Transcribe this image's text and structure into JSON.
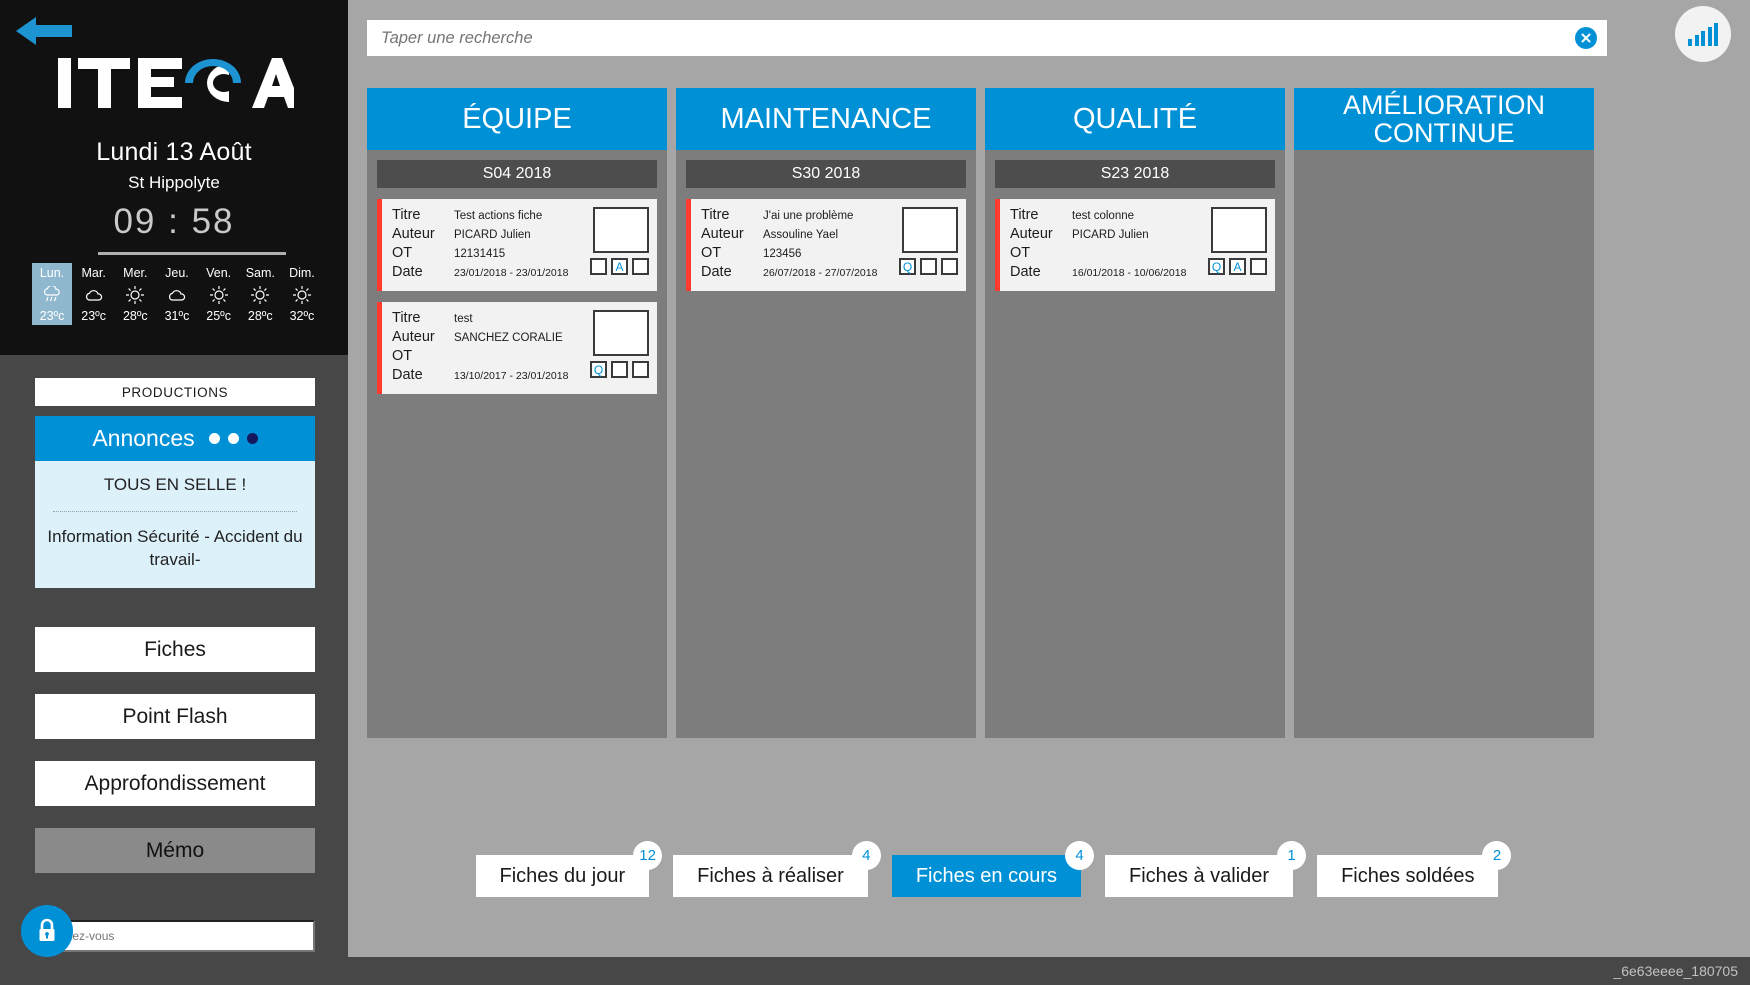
{
  "sidebar": {
    "back_icon": "back-arrow-icon",
    "logo_text": "ITECA",
    "date": "Lundi 13 Août",
    "city": "St Hippolyte",
    "clock": "09 : 58",
    "forecast": [
      {
        "day": "Lun.",
        "icon": "rain-icon",
        "temp": "23ºc",
        "active": true
      },
      {
        "day": "Mar.",
        "icon": "cloud-icon",
        "temp": "23ºc",
        "active": false
      },
      {
        "day": "Mer.",
        "icon": "sun-icon",
        "temp": "28ºc",
        "active": false
      },
      {
        "day": "Jeu.",
        "icon": "cloud-icon",
        "temp": "31ºc",
        "active": false
      },
      {
        "day": "Ven.",
        "icon": "sun-icon",
        "temp": "25ºc",
        "active": false
      },
      {
        "day": "Sam.",
        "icon": "sun-icon",
        "temp": "28ºc",
        "active": false
      },
      {
        "day": "Dim.",
        "icon": "sun-icon",
        "temp": "32ºc",
        "active": false
      }
    ],
    "productions_label": "PRODUCTIONS",
    "annonces": {
      "title": "Annonces",
      "dots_total": 3,
      "dot_selected_index": 2,
      "headline": "TOUS EN SELLE !",
      "body": "Information Sécurité - Accident du travail-"
    },
    "buttons": {
      "fiches": "Fiches",
      "point_flash": "Point Flash",
      "approfondissement": "Approfondissement",
      "memo": "Mémo"
    },
    "login": {
      "lock_icon": "lock-icon",
      "placeholder": "Identifiez-vous",
      "value": ""
    }
  },
  "topbar": {
    "search": {
      "placeholder": "Taper une recherche",
      "value": "",
      "clear_icon": "close-circle-icon"
    },
    "signal_icon": "signal-bars-icon"
  },
  "board": {
    "columns": [
      {
        "title": "ÉQUIPE",
        "week": "S04 2018",
        "cards": [
          {
            "labels": {
              "titre": "Titre",
              "auteur": "Auteur",
              "ot": "OT",
              "date": "Date"
            },
            "titre": "Test actions fiche",
            "auteur": "PICARD Julien",
            "ot": "12131415",
            "date": "23/01/2018 - 23/01/2018",
            "checks": [
              "",
              "A",
              ""
            ]
          },
          {
            "labels": {
              "titre": "Titre",
              "auteur": "Auteur",
              "ot": "OT",
              "date": "Date"
            },
            "titre": "test",
            "auteur": "SANCHEZ CORALIE",
            "ot": "",
            "date": "13/10/2017 - 23/01/2018",
            "checks": [
              "Q",
              "",
              ""
            ]
          }
        ]
      },
      {
        "title": "MAINTENANCE",
        "week": "S30 2018",
        "cards": [
          {
            "labels": {
              "titre": "Titre",
              "auteur": "Auteur",
              "ot": "OT",
              "date": "Date"
            },
            "titre": "J'ai une problème",
            "auteur": "Assouline Yael",
            "ot": "123456",
            "date": "26/07/2018 - 27/07/2018",
            "checks": [
              "Q",
              "",
              ""
            ]
          }
        ]
      },
      {
        "title": "QUALITÉ",
        "week": "S23 2018",
        "cards": [
          {
            "labels": {
              "titre": "Titre",
              "auteur": "Auteur",
              "ot": "OT",
              "date": "Date"
            },
            "titre": "test colonne",
            "auteur": "PICARD Julien",
            "ot": "",
            "date": "16/01/2018 - 10/06/2018",
            "checks": [
              "Q",
              "A",
              ""
            ]
          }
        ]
      },
      {
        "title": "AMÉLIORATION CONTINUE",
        "week": "",
        "cards": []
      }
    ]
  },
  "tabs": [
    {
      "label": "Fiches du jour",
      "count": "12",
      "active": false
    },
    {
      "label": "Fiches à réaliser",
      "count": "4",
      "active": false
    },
    {
      "label": "Fiches en cours",
      "count": "4",
      "active": true
    },
    {
      "label": "Fiches à valider",
      "count": "1",
      "active": false
    },
    {
      "label": "Fiches soldées",
      "count": "2",
      "active": false
    }
  ],
  "footer": {
    "build_id": "_6e63eeee_180705"
  },
  "colors": {
    "accent": "#0090d6",
    "card_accent": "#ff3b30",
    "sidebar_dark": "#111111",
    "sidebar_gray": "#474747",
    "board_gray": "#7d7d7d",
    "page_bg": "#a6a6a6"
  }
}
